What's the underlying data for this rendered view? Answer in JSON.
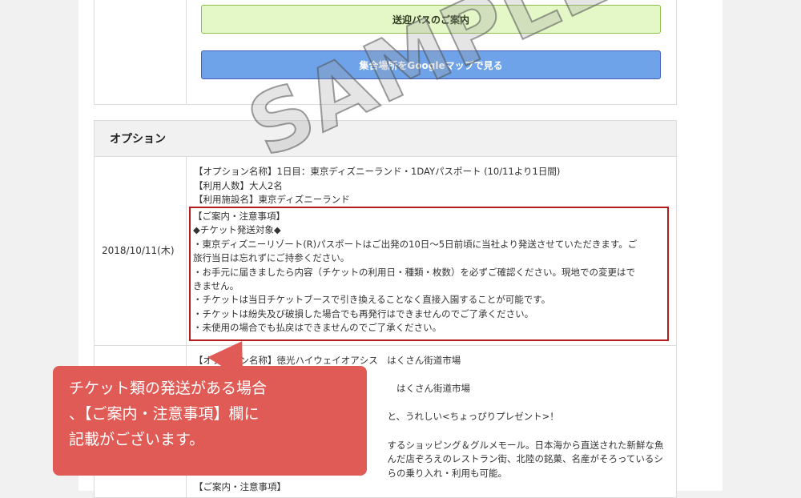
{
  "buttons": {
    "bus_label": "送迎バスのご案内",
    "map_label": "集合場所をGoogleマップで見る"
  },
  "options": {
    "title": "オプション",
    "rows": [
      {
        "date": "2018/10/11(木)",
        "lines": [
          "【オプション名称】1日目：東京ディズニーランド・1DAYパスポート (10/11より1日間)",
          "【利用人数】大人2名",
          "【利用施設名】東京ディズニーランド"
        ],
        "notes": [
          "【ご案内・注意事項】",
          "◆チケット発送対象◆",
          "・東京ディズニーリゾート(R)パスポートはご出発の10日～5日前頃に当社より発送させていただきます。ご",
          "旅行当日は忘れずにご持参ください。",
          "・お手元に届きましたら内容（チケットの利用日・種類・枚数）を必ずご確認ください。現地での変更はで",
          "きません。",
          "・チケットは当日チケットブースで引き換えることなく直接入園することが可能です。",
          "・チケットは紛失及び破損した場合でも再発行はできませんのでご了承ください。",
          "・未使用の場合でも払戻はできませんのでご了承ください。"
        ]
      },
      {
        "lines": [
          "【オプション名称】徳光ハイウェイオアシス　はくさん街道市場",
          "",
          "　　　　　　　　　　　　　　　　　　　　　　はくさん街道市場",
          "",
          "　　　　　　　　　　　　　　　　　　　　　と、うれしい<ちょっぴりプレゼント>！",
          "",
          "　　　　　　　　　　　　　　　　　　　　　するショッピング＆グルメモール。日本海から直送された新鮮な魚",
          "　　　　　　　　　　　　　　　　　　　　　んだ店ぞろえのレストラン街、北陸の銘菓、名産がそろっているシ",
          "　　　　　　　　　　　　　　　　　　　　　らの乗り入れ・利用も可能。",
          "【ご案内・注意事項】"
        ]
      }
    ]
  },
  "callout": {
    "lines": [
      "チケット類の発送がある場合",
      "、【ご案内・注意事項】欄に",
      "記載がございます。"
    ]
  },
  "watermark": "SAMPLE"
}
